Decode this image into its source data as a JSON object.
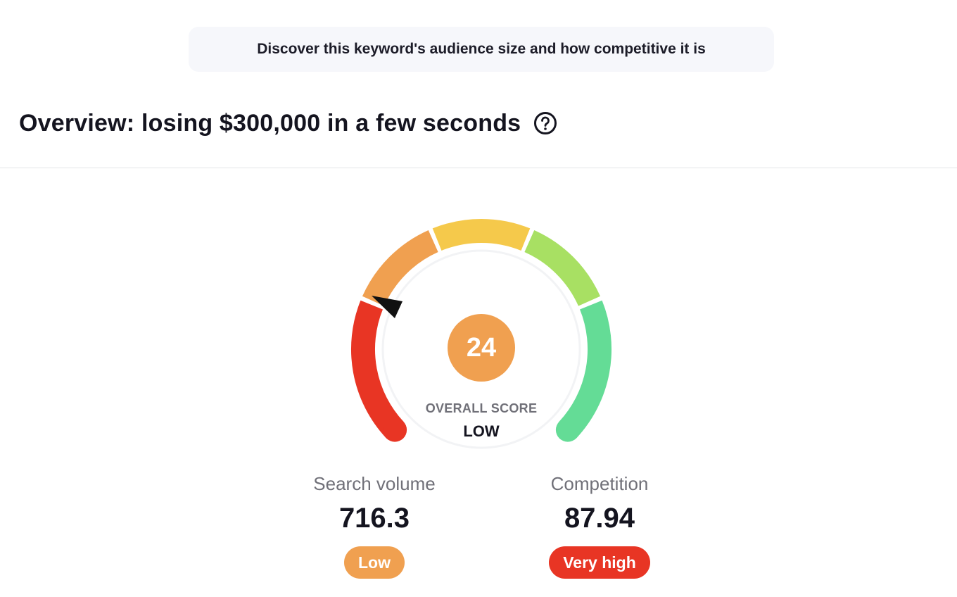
{
  "banner": {
    "text": "Discover this keyword's audience size and how competitive it is"
  },
  "overview": {
    "title": "Overview: losing $300,000 in a few seconds",
    "help_icon": "question-circle-icon"
  },
  "gauge": {
    "score": "24",
    "score_color": "#f0a050",
    "overall_label": "OVERALL SCORE",
    "overall_value": "LOW",
    "segment_colors": [
      "#e83524",
      "#f0a050",
      "#f5c94b",
      "#a8e063",
      "#64dc96"
    ],
    "pointer_icon": "arrow-pointer-icon"
  },
  "metrics": {
    "search_volume": {
      "label": "Search volume",
      "value": "716.3",
      "badge": "Low",
      "badge_color": "#f0a050"
    },
    "competition": {
      "label": "Competition",
      "value": "87.94",
      "badge": "Very high",
      "badge_color": "#e83524"
    }
  }
}
